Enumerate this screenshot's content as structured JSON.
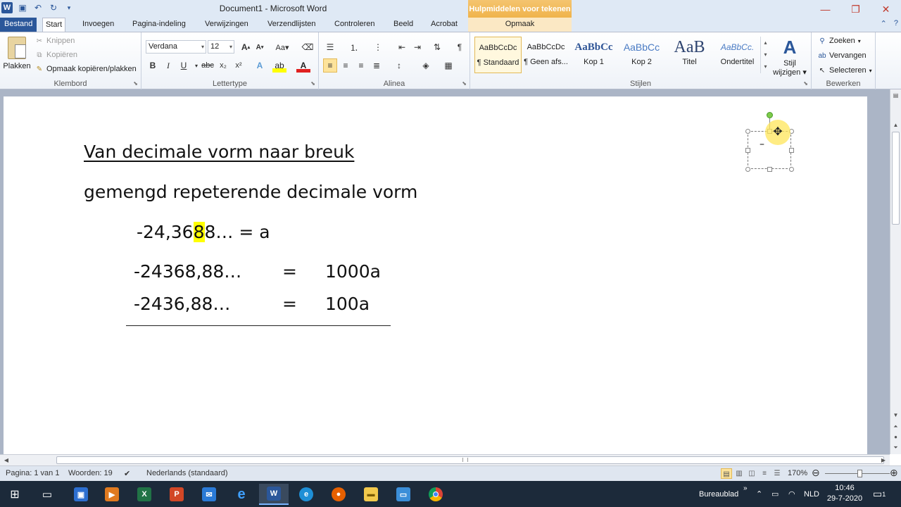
{
  "titlebar": {
    "title": "Document1 - Microsoft Word",
    "contextual_tab_group": "Hulpmiddelen voor tekenen"
  },
  "tabs": {
    "file": "Bestand",
    "start": "Start",
    "insert": "Invoegen",
    "layout": "Pagina-indeling",
    "references": "Verwijzingen",
    "mailings": "Verzendlijsten",
    "review": "Controleren",
    "view": "Beeld",
    "acrobat": "Acrobat",
    "format": "Opmaak"
  },
  "clipboard": {
    "paste": "Plakken",
    "cut": "Knippen",
    "copy": "Kopiëren",
    "format_painter": "Opmaak kopiëren/plakken",
    "label": "Klembord"
  },
  "font": {
    "name": "Verdana",
    "size": "12",
    "label": "Lettertype"
  },
  "paragraph": {
    "label": "Alinea"
  },
  "styles": {
    "label": "Stijlen",
    "items": [
      {
        "sample": "AaBbCcDc",
        "name": "¶ Standaard"
      },
      {
        "sample": "AaBbCcDc",
        "name": "¶ Geen afs..."
      },
      {
        "sample": "AaBbCc",
        "name": "Kop 1"
      },
      {
        "sample": "AaBbCc",
        "name": "Kop 2"
      },
      {
        "sample": "AaB",
        "name": "Titel"
      },
      {
        "sample": "AaBbCc.",
        "name": "Ondertitel"
      }
    ],
    "change_styles_line1": "Stijl",
    "change_styles_line2": "wijzigen"
  },
  "editing": {
    "find": "Zoeken",
    "replace": "Vervangen",
    "select": "Selecteren",
    "label": "Bewerken"
  },
  "document": {
    "title": "Van decimale vorm naar breuk",
    "subtitle": "gemengd repeterende decimale vorm",
    "eq1_before": "-24,36",
    "eq1_highlight": "8",
    "eq1_after": "8…  = a",
    "row1": {
      "left": "-24368,88…",
      "eq": "=",
      "right": "1000a"
    },
    "row2": {
      "left": "-2436,88…",
      "eq": "=",
      "right": "100a"
    },
    "textbox_text": "–"
  },
  "statusbar": {
    "page": "Pagina: 1 van 1",
    "words": "Woorden: 19",
    "language": "Nederlands (standaard)",
    "zoom": "170%"
  },
  "taskbar": {
    "desktop": "Bureaublad",
    "lang": "NLD",
    "time": "10:46",
    "date": "29-7-2020",
    "notif_count": "1"
  },
  "colors": {
    "word_blue": "#2b579a",
    "highlight": "#ffff00",
    "contextual": "#f0b34a"
  }
}
